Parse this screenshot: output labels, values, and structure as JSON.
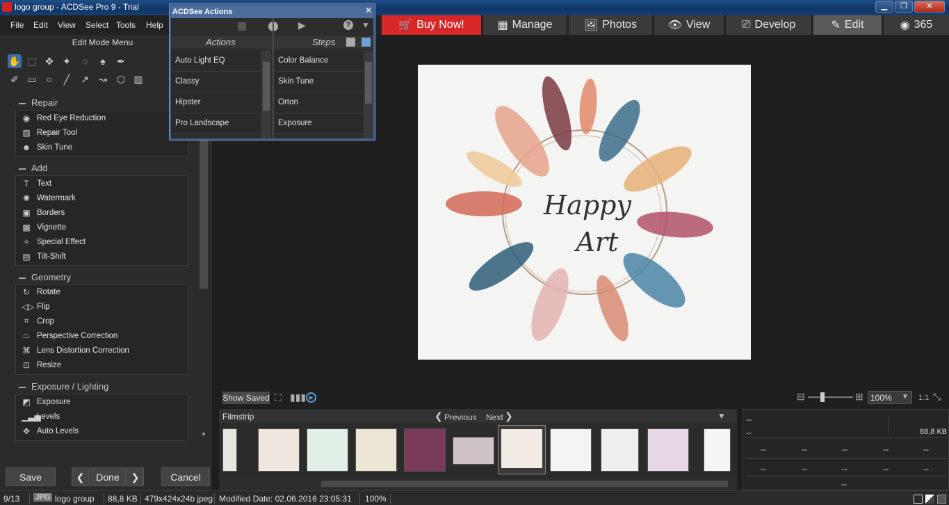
{
  "window": {
    "title": "logo group - ACDSee Pro 9 - Trial",
    "controls": [
      "minimize-icon",
      "maximize-icon",
      "close-icon"
    ]
  },
  "menu": [
    "File",
    "Edit",
    "View",
    "Select",
    "Tools",
    "Help"
  ],
  "modes": {
    "buy_now": "Buy Now!",
    "tabs": [
      "Manage",
      "Photos",
      "View",
      "Develop",
      "Edit",
      "365"
    ],
    "active": "Edit",
    "buy_color": "#d92727"
  },
  "left_panel": {
    "title": "Edit Mode Menu",
    "sections": [
      {
        "title": "Repair",
        "items": [
          {
            "label": "Red Eye Reduction",
            "icon": "eye-icon"
          },
          {
            "label": "Repair Tool",
            "icon": "bandage-icon"
          },
          {
            "label": "Skin Tune",
            "icon": "person-icon"
          }
        ]
      },
      {
        "title": "Add",
        "items": [
          {
            "label": "Text",
            "icon": "text-icon"
          },
          {
            "label": "Watermark",
            "icon": "watermark-icon"
          },
          {
            "label": "Borders",
            "icon": "border-icon"
          },
          {
            "label": "Vignette",
            "icon": "vignette-icon"
          },
          {
            "label": "Special Effect",
            "icon": "wand-icon"
          },
          {
            "label": "Tilt-Shift",
            "icon": "tiltshift-icon"
          }
        ]
      },
      {
        "title": "Geometry",
        "items": [
          {
            "label": "Rotate",
            "icon": "rotate-icon"
          },
          {
            "label": "Flip",
            "icon": "flip-icon"
          },
          {
            "label": "Crop",
            "icon": "crop-icon"
          },
          {
            "label": "Perspective Correction",
            "icon": "perspective-icon"
          },
          {
            "label": "Lens Distortion Correction",
            "icon": "lens-icon"
          },
          {
            "label": "Resize",
            "icon": "resize-icon"
          }
        ]
      },
      {
        "title": "Exposure / Lighting",
        "items": [
          {
            "label": "Exposure",
            "icon": "exposure-icon"
          },
          {
            "label": "Levels",
            "icon": "levels-icon"
          },
          {
            "label": "Auto Levels",
            "icon": "auto-levels-icon"
          }
        ]
      }
    ],
    "buttons": {
      "save": "Save",
      "done": "Done",
      "cancel": "Cancel"
    }
  },
  "actions_dialog": {
    "title": "ACDSee Actions",
    "actions_header": "Actions",
    "steps_header": "Steps",
    "actions": [
      "Auto Light EQ",
      "Classy",
      "Hipster",
      "Pro Landscape"
    ],
    "steps": [
      "Color Balance",
      "Skin Tune",
      "Orton",
      "Exposure"
    ]
  },
  "image": {
    "text_line1": "Happy",
    "text_line2": "Art"
  },
  "view_bar": {
    "show_saved": "Show Saved",
    "zoom": "100%",
    "one_to_one": "1:1",
    "zoom_level": 0.33
  },
  "filmstrip": {
    "label": "Filmstrip",
    "previous": "Previous",
    "next": "Next"
  },
  "info_panel": {
    "row1": "--",
    "row2": "--",
    "size": "88,8 KB",
    "cells": [
      "--",
      "--",
      "--",
      "--",
      "--",
      "--",
      "--",
      "--",
      "--",
      "--"
    ],
    "bottom": "--"
  },
  "status": {
    "index": "9/13",
    "format": "JPG",
    "name": "logo group",
    "size": "88,8 KB",
    "dims": "479x424x24b jpeg",
    "modified": "Modified Date: 02.06.2016 23:05:31",
    "zoom": "100%"
  }
}
